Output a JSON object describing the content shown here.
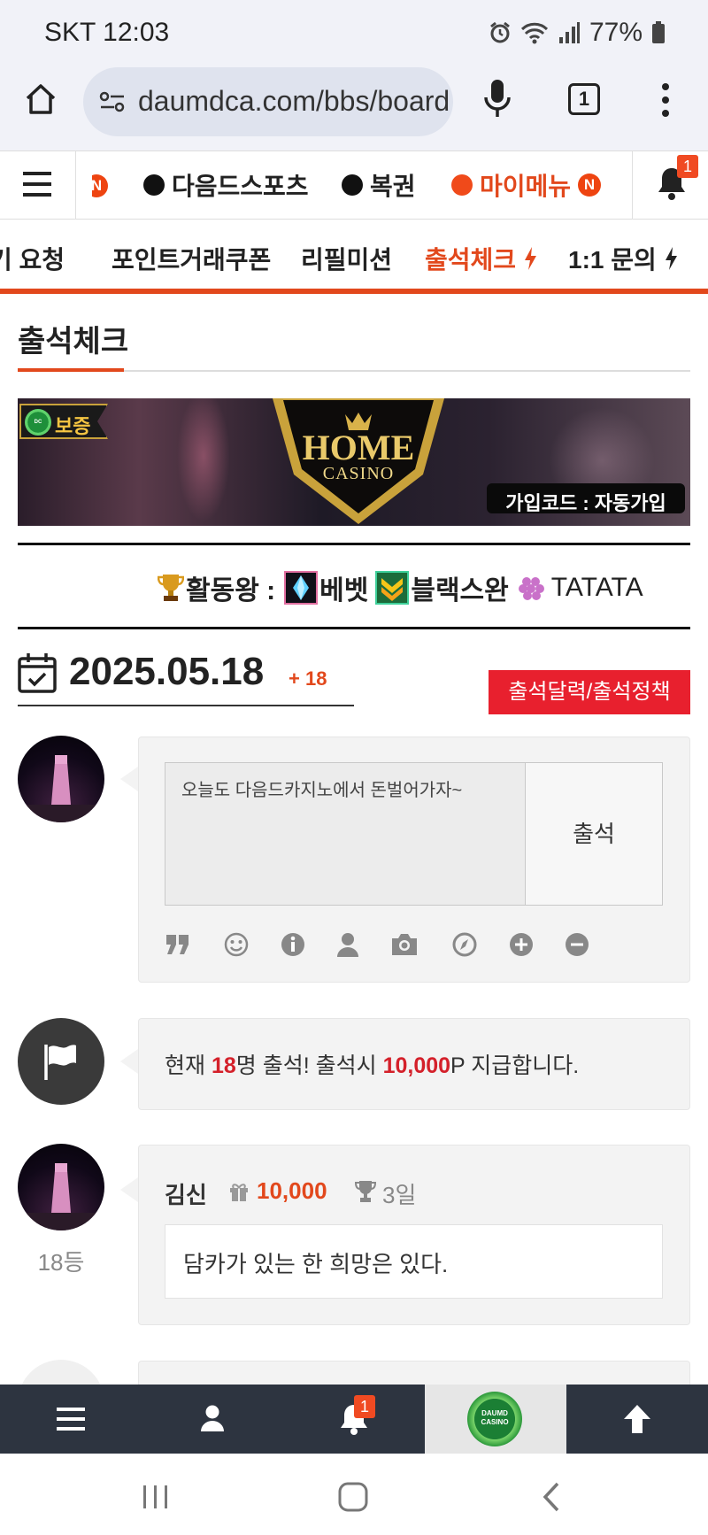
{
  "status_bar": {
    "time": "SKT 12:03",
    "battery": "77%"
  },
  "browser": {
    "url": "daumdca.com/bbs/board",
    "tab_count": "1"
  },
  "top_nav": {
    "partial_badge": "N",
    "items": [
      {
        "label": "다음드스포츠",
        "badge": ""
      },
      {
        "label": "복권",
        "badge": ""
      },
      {
        "label": "마이메뉴",
        "badge": "N"
      }
    ],
    "bell_badge": "1"
  },
  "sub_nav": {
    "items": [
      {
        "label": "기 요청"
      },
      {
        "label": "포인트거래쿠폰"
      },
      {
        "label": "리필미션"
      },
      {
        "label": "출석체크"
      },
      {
        "label": "1:1 문의"
      }
    ]
  },
  "page": {
    "title": "출석체크"
  },
  "banner": {
    "guarantee": "보증",
    "logo_main": "HOME",
    "logo_sub": "CASINO",
    "logo_badge": "DAUMD CASINO",
    "code_text": "가입코드 : 자동가입"
  },
  "ticker": {
    "label": "활동왕 :",
    "names": [
      "베벳",
      "블랙스완",
      "TATATA"
    ]
  },
  "attendance": {
    "date": "2025.05.18",
    "count_delta": "+ 18",
    "calendar_button": "출석달력/출석정책",
    "textarea_value": "오늘도 다음드카지노에서 돈벌어가자~",
    "submit_button": "출석",
    "tools": [
      "quote-icon",
      "smile-icon",
      "info-icon",
      "user-icon",
      "camera-icon",
      "compass-icon",
      "plus-circle-icon",
      "minus-circle-icon"
    ]
  },
  "notice": {
    "prefix": "현재 ",
    "count": "18",
    "mid": "명 출석! 출석시 ",
    "points": "10,000",
    "suffix": "P 지급합니다."
  },
  "entries": [
    {
      "name": "김신",
      "points": "10,000",
      "days": "3일",
      "rank": "18등",
      "message": "담카가 있는 한 희망은 있다."
    }
  ],
  "bottom_bar": {
    "notification_badge": "1",
    "logo_text": "DAUMD CASINO"
  },
  "colors": {
    "accent": "#e2481c",
    "button_red": "#e8202e",
    "bottom_bar": "#2d3440"
  }
}
